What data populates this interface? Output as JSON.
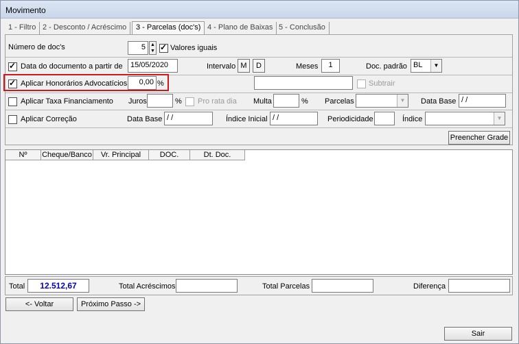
{
  "window": {
    "title": "Movimento"
  },
  "tabs": [
    "1 - Filtro",
    "2 - Desconto / Acréscimo",
    "3 - Parcelas (doc's)",
    "4 - Plano de Baixas",
    "5 - Conclusão"
  ],
  "row1": {
    "num_docs_label": "Número de doc's",
    "num_docs_value": "5",
    "valores_iguais_label": "Valores iguais",
    "valores_iguais_checked": true
  },
  "row2": {
    "data_doc_label": "Data do documento a partir de",
    "data_doc_checked": true,
    "data_doc_value": "15/05/2020",
    "intervalo_label": "Intervalo",
    "m_label": "M",
    "d_label": "D",
    "meses_label": "Meses",
    "meses_value": "1",
    "doc_padrao_label": "Doc. padrão",
    "doc_padrao_value": "BL"
  },
  "row3": {
    "honorarios_label": "Aplicar Honorários Advocatícios",
    "honorarios_checked": true,
    "honorarios_value": "0,00",
    "percent": "%",
    "subtrair_label": "Subtrair",
    "subtrair_checked": false
  },
  "row4": {
    "taxa_label": "Aplicar Taxa Financiamento",
    "taxa_checked": false,
    "juros_label": "Juros",
    "percent": "%",
    "pro_rata_label": "Pro rata dia",
    "multa_label": "Multa",
    "parcelas_label": "Parcelas",
    "data_base_label": "Data Base",
    "data_base_value": " / /"
  },
  "row5": {
    "correcao_label": "Aplicar Correção",
    "correcao_checked": false,
    "data_base_label": "Data Base",
    "data_base_value": " / /",
    "indice_inicial_label": "Índice Inicial",
    "indice_inicial_value": " / /",
    "periodicidade_label": "Periodicidade",
    "indice_label": "Índice"
  },
  "preencher_grade_label": "Preencher Grade",
  "grid": {
    "columns": [
      "Nº",
      "Cheque/Banco",
      "Vr. Principal",
      "DOC.",
      "Dt. Doc."
    ]
  },
  "totals": {
    "total_label": "Total",
    "total_value": "12.512,67",
    "acrescimos_label": "Total Acréscimos",
    "parcelas_label": "Total Parcelas",
    "diferenca_label": "Diferença"
  },
  "buttons": {
    "voltar": "<- Voltar",
    "proximo": "Próximo Passo ->",
    "sair": "Sair"
  },
  "colors": {
    "highlight": "#d0181c",
    "total_value": "#0000c8"
  }
}
